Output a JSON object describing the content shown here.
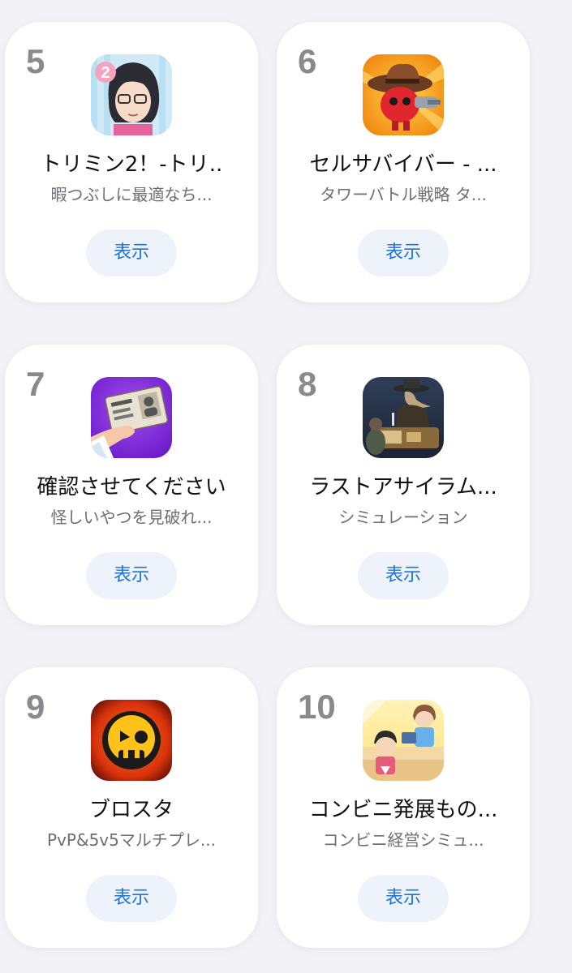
{
  "apps": [
    {
      "rank": "5",
      "name": "トリミン2！-トリ..",
      "subtitle": "暇つぶしに最適なち...",
      "button": "表示",
      "icon": "character-glasses-icon"
    },
    {
      "rank": "6",
      "name": "セルサバイバー - ...",
      "subtitle": "タワーバトル戦略 タ...",
      "button": "表示",
      "icon": "cowboy-cell-icon"
    },
    {
      "rank": "7",
      "name": "確認させてください",
      "subtitle": "怪しいやつを見破れ...",
      "button": "表示",
      "icon": "id-card-icon"
    },
    {
      "rank": "8",
      "name": "ラストアサイラム...",
      "subtitle": "シミュレーション",
      "button": "表示",
      "icon": "plague-doctor-icon"
    },
    {
      "rank": "9",
      "name": "ブロスタ",
      "subtitle": "PvP&5v5マルチプレ...",
      "button": "表示",
      "icon": "skull-badge-icon"
    },
    {
      "rank": "10",
      "name": "コンビニ発展もの...",
      "subtitle": "コンビニ経営シミュ...",
      "button": "表示",
      "icon": "convenience-store-icon"
    }
  ]
}
